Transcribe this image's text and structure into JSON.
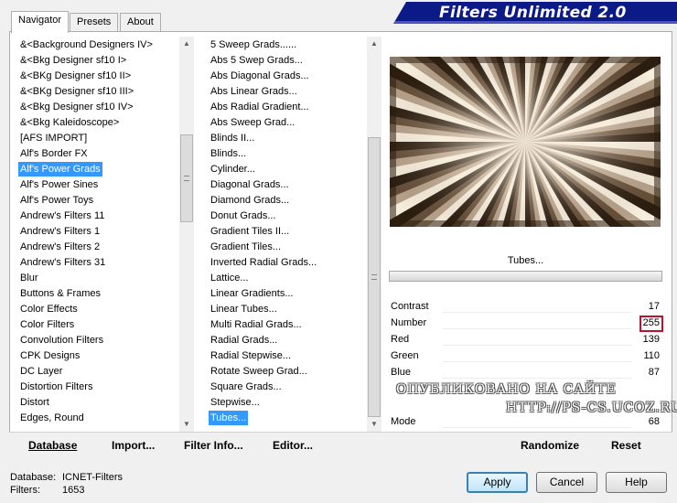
{
  "tabs": [
    {
      "label": "Navigator",
      "active": true
    },
    {
      "label": "Presets",
      "active": false
    },
    {
      "label": "About",
      "active": false
    }
  ],
  "app_title": "Filters Unlimited 2.0",
  "categories": {
    "selected_index": 8,
    "items": [
      "&<Background Designers IV>",
      "&<Bkg Designer sf10 I>",
      "&<BKg Designer sf10 II>",
      "&<BKg Designer sf10 III>",
      "&<Bkg Designer sf10 IV>",
      "&<Bkg Kaleidoscope>",
      "[AFS IMPORT]",
      "Alf's Border FX",
      "Alf's Power Grads",
      "Alf's Power Sines",
      "Alf's Power Toys",
      "Andrew's Filters 11",
      "Andrew's Filters 1",
      "Andrew's Filters 2",
      "Andrew's Filters 31",
      "Blur",
      "Buttons & Frames",
      "Color Effects",
      "Color Filters",
      "Convolution Filters",
      "CPK Designs",
      "DC Layer",
      "Distortion Filters",
      "Distort",
      "Edges, Round"
    ],
    "scroll_position": 0.3
  },
  "filters": {
    "selected_index": 24,
    "items": [
      "5 Sweep Grads......",
      "Abs 5 Swep Grads...",
      "Abs Diagonal Grads...",
      "Abs Linear Grads...",
      "Abs Radial Gradient...",
      "Abs Sweep Grad...",
      "Blinds II...",
      "Blinds...",
      "Cylinder...",
      "Diagonal Grads...",
      "Diamond Grads...",
      "Donut Grads...",
      "Gradient Tiles II...",
      "Gradient Tiles...",
      "Inverted Radial Grads...",
      "Lattice...",
      "Linear Gradients...",
      "Linear Tubes...",
      "Multi Radial Grads...",
      "Radial Grads...",
      "Radial Stepwise...",
      "Rotate Sweep Grad...",
      "Square Grads...",
      "Stepwise...",
      "Tubes..."
    ],
    "scroll_position": 1.0
  },
  "preview": {
    "filter_name": "Tubes...",
    "colors": {
      "light": "#f7eddd",
      "dark": "#2b1d10",
      "mid": "#8c7055"
    }
  },
  "sliders": [
    {
      "label": "Contrast",
      "value": "17",
      "level": 0.067
    },
    {
      "label": "Number",
      "value": "255",
      "level": 1.0,
      "highlighted": true
    },
    {
      "label": "Red",
      "value": "139",
      "level": 0.545
    },
    {
      "label": "Green",
      "value": "110",
      "level": 0.431
    },
    {
      "label": "Blue",
      "value": "87",
      "level": 0.341
    },
    {
      "label": "Mode",
      "value": "68",
      "level": 0.267
    }
  ],
  "watermark": {
    "line1": "ОПУБЛИКОВАНО   НА САЙТЕ",
    "line2": "HTTP://PS-CS.UCOZ.RU"
  },
  "left_buttons": {
    "database": "Database",
    "import": "Import...",
    "filter_info": "Filter Info...",
    "editor": "Editor..."
  },
  "right_buttons": {
    "randomize": "Randomize",
    "reset": "Reset"
  },
  "status": {
    "database_label": "Database:",
    "database_value": "ICNET-Filters",
    "filters_label": "Filters:",
    "filters_value": "1653"
  },
  "dialog_buttons": {
    "apply": "Apply",
    "cancel": "Cancel",
    "help": "Help"
  }
}
